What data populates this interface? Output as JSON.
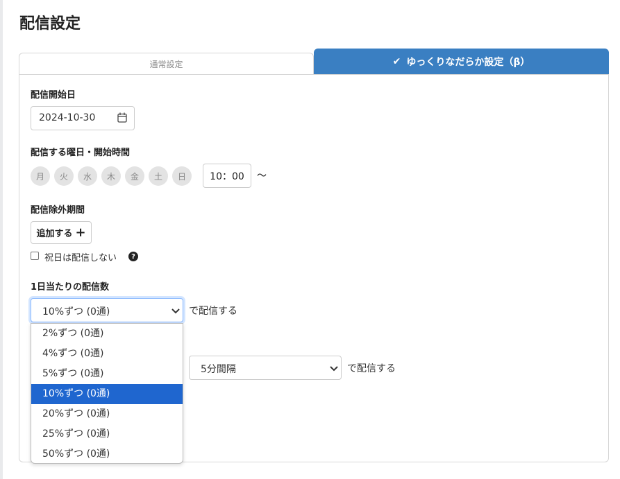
{
  "page": {
    "title": "配信設定"
  },
  "tabs": [
    {
      "label": "通常設定",
      "active": false
    },
    {
      "label": "ゆっくりなだらか設定（β）",
      "active": true
    }
  ],
  "start_date": {
    "label": "配信開始日",
    "value": "2024-10-30"
  },
  "schedule": {
    "label": "配信する曜日・開始時間",
    "weekdays": [
      "月",
      "火",
      "水",
      "木",
      "金",
      "土",
      "日"
    ],
    "time": "10：00",
    "suffix": "〜"
  },
  "exclusion": {
    "label": "配信除外期間",
    "add_button": "追加する",
    "holiday_checkbox_label": "祝日は配信しない",
    "holiday_checked": false,
    "help_icon": "?"
  },
  "daily_count": {
    "label": "1日当たりの配信数",
    "selected": "10%ずつ (0通)",
    "suffix": "で配信する",
    "options": [
      "2%ずつ (0通)",
      "4%ずつ (0通)",
      "5%ずつ (0通)",
      "10%ずつ (0通)",
      "20%ずつ (0通)",
      "25%ずつ (0通)",
      "50%ずつ (0通)"
    ],
    "highlighted_index": 3
  },
  "interval": {
    "selected": "5分間隔",
    "suffix": "で配信する"
  },
  "colors": {
    "accent": "#3a7fc2",
    "highlight": "#1f66cf",
    "weekday_bg": "#e3e3e3"
  }
}
